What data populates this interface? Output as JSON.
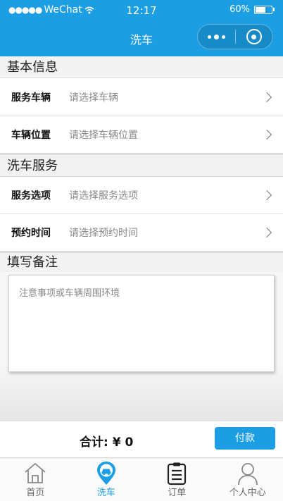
{
  "status": {
    "carrier": "WeChat",
    "time": "12:17",
    "battery": "60%"
  },
  "nav": {
    "title": "洗车"
  },
  "sections": {
    "basic": "基本信息",
    "service": "洗车服务",
    "remark": "填写备注"
  },
  "rows": {
    "vehicle": {
      "label": "服务车辆",
      "placeholder": "请选择车辆"
    },
    "location": {
      "label": "车辆位置",
      "placeholder": "请选择车辆位置"
    },
    "option": {
      "label": "服务选项",
      "placeholder": "请选择服务选项"
    },
    "time": {
      "label": "预约时间",
      "placeholder": "请选择预约时间"
    }
  },
  "remark": {
    "placeholder": "注意事项或车辆周围环境"
  },
  "paybar": {
    "total": "合计: ¥ 0",
    "pay_label": "付款"
  },
  "tabs": [
    {
      "label": "首页",
      "icon": "home-icon"
    },
    {
      "label": "洗车",
      "icon": "car-wash-pin-icon"
    },
    {
      "label": "订单",
      "icon": "orders-icon"
    },
    {
      "label": "个人中心",
      "icon": "user-icon"
    }
  ],
  "colors": {
    "accent": "#1b9ee4"
  }
}
